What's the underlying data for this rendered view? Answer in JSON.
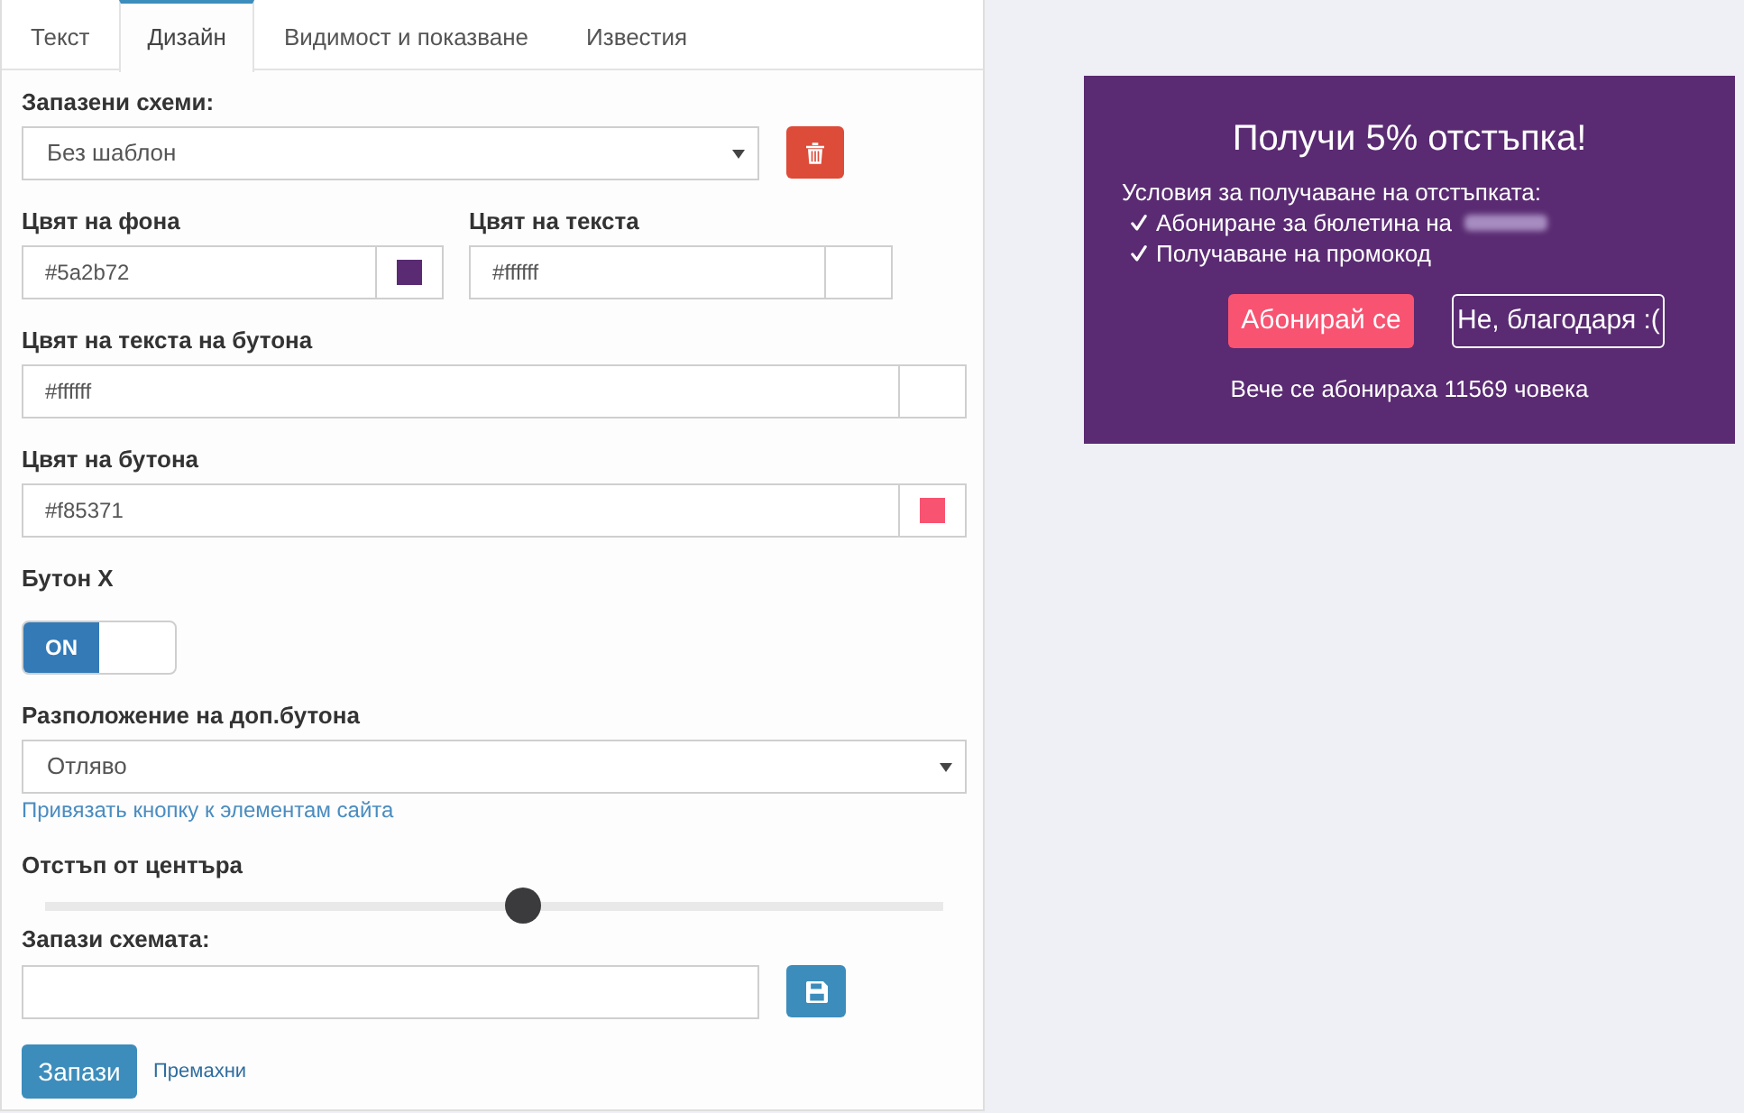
{
  "tabs": [
    {
      "label": "Текст",
      "selected": false
    },
    {
      "label": "Дизайн",
      "selected": true
    },
    {
      "label": "Видимост и показване",
      "selected": false
    },
    {
      "label": "Известия",
      "selected": false
    }
  ],
  "design_form": {
    "saved_schemes": {
      "label": "Запазени схеми:",
      "value": "Без шаблон"
    },
    "color_rows": [
      [
        {
          "label": "Цвят на фона",
          "value": "#5a2b72",
          "color": "#5a2b72"
        },
        {
          "label": "Цвят на текста",
          "value": "#ffffff"
        }
      ],
      [
        {
          "label": "Цвят на текста на бутона",
          "value": "#ffffff"
        }
      ],
      [
        {
          "label": "Цвят на бутона",
          "value": "#f85371",
          "color": "#f85371"
        }
      ]
    ],
    "close_button": {
      "label": "Бутон X",
      "on": true,
      "state_label": "ON"
    },
    "button_position": {
      "label": "Разположение на доп.бутона",
      "value": "Отляво",
      "link": "Привязать кнопку к элементам сайта"
    },
    "offset": {
      "label": "Отстъп от центъра",
      "level": 0.533
    },
    "save_scheme": {
      "label": "Запази схемата:"
    },
    "actions": {
      "save": "Запази",
      "remove": "Премахни"
    }
  },
  "preview": {
    "title": "Получи 5% отстъпка!",
    "intro": "Условия за получаване на отстъпката:",
    "conditions": [
      {
        "text": "Абониране за бюлетина на",
        "blurred": true
      },
      {
        "text": "Получаване на промокод",
        "blurred": false
      }
    ],
    "buttons": [
      {
        "label": "Абонирай се",
        "kind": "primary"
      },
      {
        "label": "Не, благодаря :(",
        "kind": "outline"
      }
    ],
    "footer": "Вече се абонираха 11569 човека"
  }
}
